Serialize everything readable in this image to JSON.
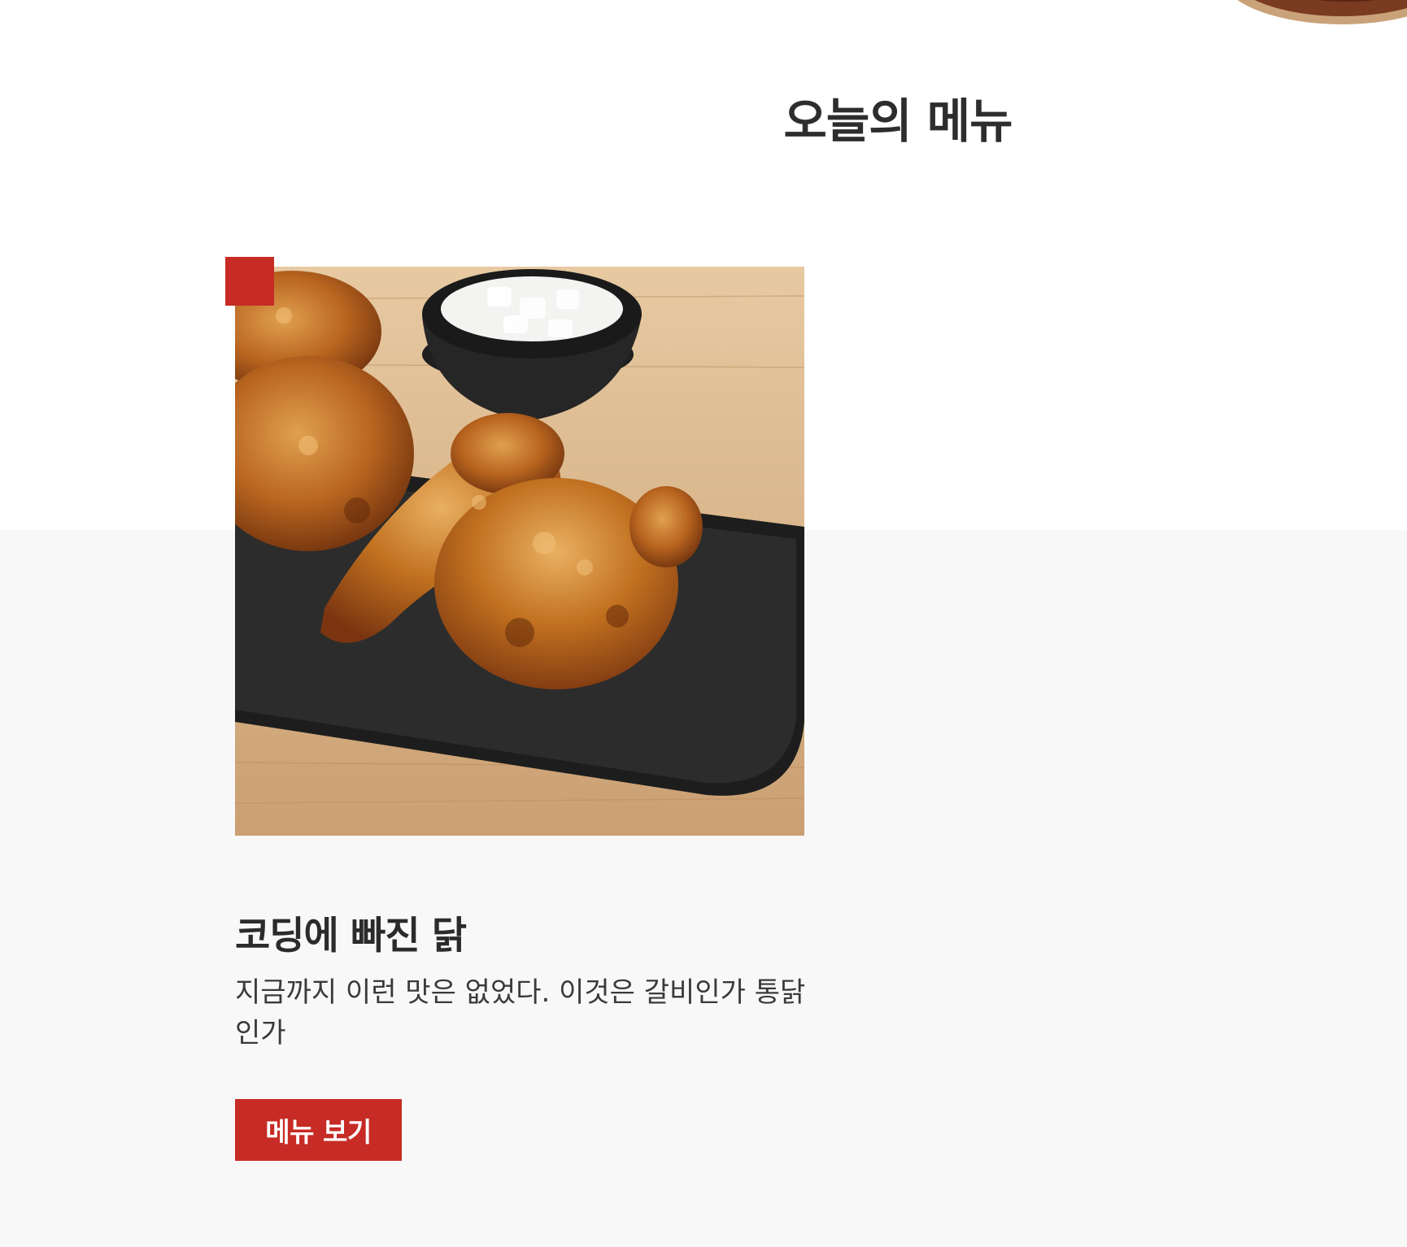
{
  "section": {
    "title": "오늘의 메뉴"
  },
  "menu_card": {
    "name": "코딩에 빠진 닭",
    "description": "지금까지 이런 맛은 없었다. 이것은 갈비인가 통닭인가",
    "button_label": "메뉴 보기",
    "photo_alt": "양념 치킨"
  },
  "colors": {
    "accent": "#c62b25",
    "heading": "#2d2d2d",
    "lower_background": "#f8f8f8"
  }
}
